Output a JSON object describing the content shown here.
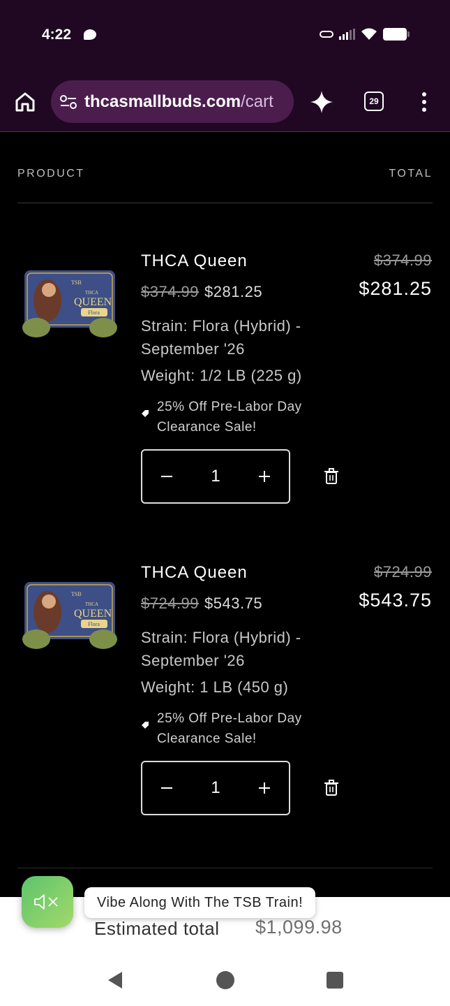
{
  "status_bar": {
    "time": "4:22"
  },
  "browser": {
    "url_domain": "thcasmallbuds.com",
    "url_path": "/cart",
    "tab_count": "29"
  },
  "cart": {
    "header_product": "PRODUCT",
    "header_total": "TOTAL",
    "items": [
      {
        "name": "THCA Queen",
        "price_original": "$374.99",
        "price_sale": "$281.25",
        "strain": "Strain: Flora (Hybrid) - September '26",
        "weight": "Weight: 1/2 LB (225 g)",
        "discount": "25% Off Pre-Labor Day Clearance Sale!",
        "quantity": "1",
        "total_original": "$374.99",
        "total_sale": "$281.25",
        "image_text": {
          "brand": "TSB",
          "line1": "THCA",
          "line2": "QUEEN",
          "strain": "Flora"
        }
      },
      {
        "name": "THCA Queen",
        "price_original": "$724.99",
        "price_sale": "$543.75",
        "strain": "Strain: Flora (Hybrid) - September '26",
        "weight": "Weight: 1 LB (450 g)",
        "discount": "25% Off Pre-Labor Day Clearance Sale!",
        "quantity": "1",
        "total_original": "$724.99",
        "total_sale": "$543.75",
        "image_text": {
          "brand": "TSB",
          "line1": "THCA",
          "line2": "QUEEN",
          "strain": "Flora"
        }
      }
    ]
  },
  "footer": {
    "estimated_label": "Estimated total",
    "estimated_value": "$1,099.98"
  },
  "music_widget": {
    "tooltip": "Vibe Along With The TSB Train!"
  },
  "colors": {
    "browser_chrome": "#200822",
    "url_pill": "#4b1d4d",
    "page_background": "#000000",
    "mute_button_start": "#5ec46d",
    "mute_button_end": "#a2d96a"
  },
  "icons": [
    "home-icon",
    "tune-icon",
    "sparkle-icon",
    "tabs-icon",
    "menu-icon",
    "tag-icon",
    "minus-icon",
    "plus-icon",
    "trash-icon",
    "mute-icon",
    "back-icon",
    "home-circle-icon",
    "recents-icon"
  ]
}
